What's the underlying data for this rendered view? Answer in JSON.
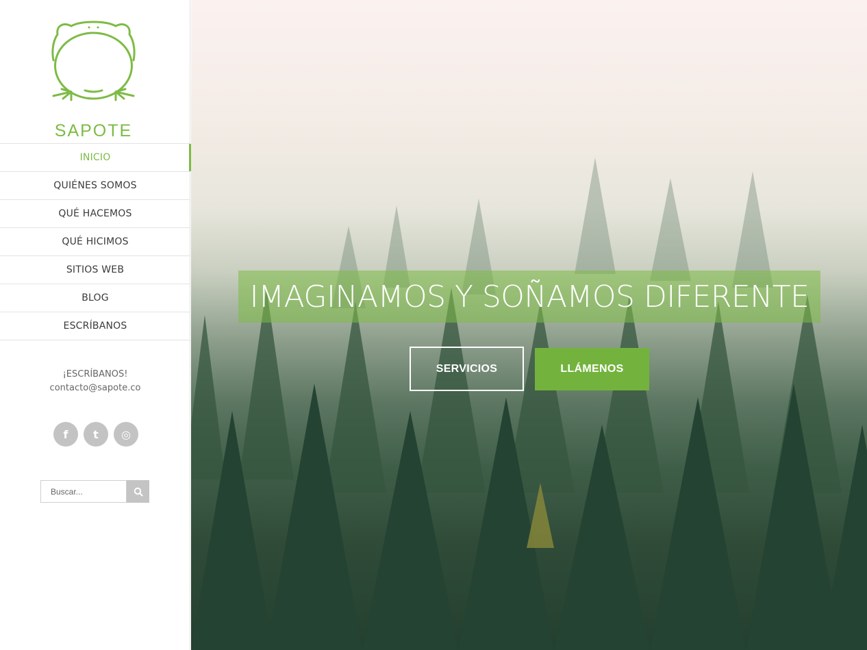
{
  "brand": {
    "name": "SAPOTE",
    "color": "#7dbb45"
  },
  "nav": {
    "items": [
      {
        "label": "INICIO",
        "active": true
      },
      {
        "label": "QUIÉNES SOMOS",
        "active": false
      },
      {
        "label": "QUÉ HACEMOS",
        "active": false
      },
      {
        "label": "QUÉ HICIMOS",
        "active": false
      },
      {
        "label": "SITIOS WEB",
        "active": false
      },
      {
        "label": "BLOG",
        "active": false
      },
      {
        "label": "ESCRÍBANOS",
        "active": false
      }
    ]
  },
  "contact": {
    "title": "¡ESCRÍBANOS!",
    "email": "contacto@sapote.co"
  },
  "social": [
    {
      "icon": "facebook-icon",
      "glyph": "f"
    },
    {
      "icon": "twitter-icon",
      "glyph": "t"
    },
    {
      "icon": "instagram-icon",
      "glyph": "◎"
    }
  ],
  "search": {
    "placeholder": "Buscar..."
  },
  "hero": {
    "headline": "IMAGINAMOS Y SOÑAMOS DIFERENTE",
    "btn_services": "SERVICIOS",
    "btn_call": "LLÁMENOS"
  }
}
